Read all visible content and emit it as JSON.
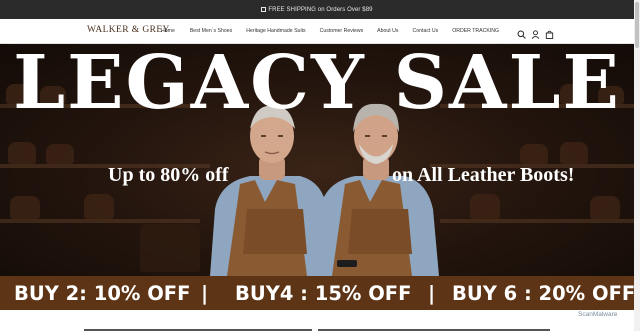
{
  "announcement": {
    "text": "FREE SHIPPING on Orders Over $89",
    "icon": "box-icon"
  },
  "header": {
    "logo": "WALKER & GREY",
    "nav": [
      "Home",
      "Best Men`s Shoes",
      "Heritage Handmade Suits",
      "Customer Reviews",
      "About Us",
      "Contact Us",
      "ORDER TRACKING"
    ],
    "icons": [
      "search-icon",
      "account-icon",
      "cart-icon"
    ]
  },
  "hero": {
    "title": "LEGACY SALE",
    "subtitle_left": "Up to 80% off",
    "subtitle_right": "on All Leather Boots!"
  },
  "promo": {
    "items": [
      "BUY 2: 10% OFF",
      "|",
      "BUY4 : 15% OFF",
      "|",
      "BUY 6 : 20% OFF"
    ]
  },
  "watermark": "ScanMalware",
  "colors": {
    "announce_bg": "#2b2b2b",
    "promo_bg": "#5e3416",
    "logo": "#4a3020"
  }
}
